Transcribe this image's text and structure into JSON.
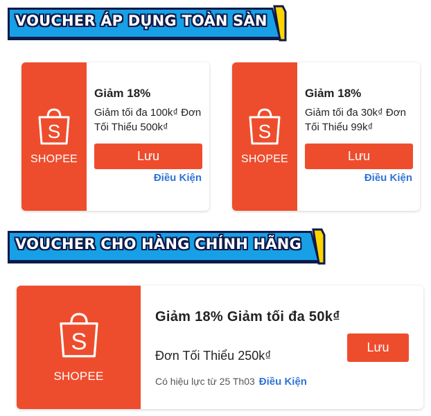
{
  "section_all": {
    "title": "VOUCHER ÁP DỤNG TOÀN SÀN"
  },
  "section_brand": {
    "title": "VOUCHER CHO HÀNG CHÍNH HÃNG"
  },
  "brand_name": "SHOPEE",
  "vouchers_all": [
    {
      "title": "Giảm 18%",
      "desc": "Giảm tối đa 100k₫ Đơn Tối Thiểu 500k₫",
      "save_label": "Lưu",
      "condition_label": "Điều Kiện"
    },
    {
      "title": "Giảm 18%",
      "desc": "Giảm tối đa 30k₫ Đơn Tối Thiểu 99k₫",
      "save_label": "Lưu",
      "condition_label": "Điều Kiện"
    }
  ],
  "voucher_brand": {
    "title": "Giảm 18% Giảm tối đa 50k₫",
    "desc": "Đơn Tối Thiểu 250k₫",
    "validity": "Có hiệu lực từ 25 Th03",
    "save_label": "Lưu",
    "condition_label": "Điều Kiện"
  },
  "colors": {
    "accent": "#ee4d2d",
    "banner_fill": "#18a0e6",
    "banner_outline": "#0d1a4a",
    "banner_side": "#ffd400",
    "link": "#2f74d6"
  },
  "icons": {
    "stub": "shopping-bag-s-icon"
  }
}
